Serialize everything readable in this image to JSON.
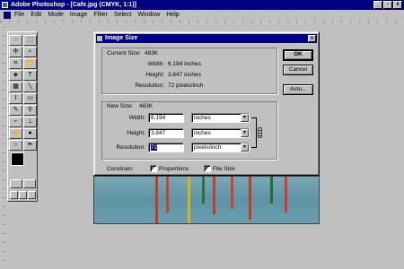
{
  "app": {
    "title": "Adobe Photoshop - [Cafe.jpg  (CMYK, 1:1)]"
  },
  "menu": [
    "File",
    "Edit",
    "Mode",
    "Image",
    "Filter",
    "Select",
    "Window",
    "Help"
  ],
  "tools": [
    "lasso",
    "marquee",
    "move",
    "magnifier",
    "crop",
    "hand",
    "paint-bucket",
    "type",
    "gradient",
    "line",
    "eyedropper",
    "eraser",
    "pencil",
    "airbrush",
    "paintbrush",
    "stamp",
    "smudge",
    "blur",
    "dodge",
    "pen"
  ],
  "dialog": {
    "title": "Image Size",
    "current": {
      "size_label": "Current Size:",
      "size_value": "483K",
      "width_label": "Width:",
      "width_value": "6.194 inches",
      "height_label": "Height:",
      "height_value": "3.847 inches",
      "resolution_label": "Resolution:",
      "resolution_value": "72 pixels/inch"
    },
    "new": {
      "size_label": "New Size:",
      "size_value": "483K",
      "width_label": "Width:",
      "width_value": "6.194",
      "width_unit": "inches",
      "height_label": "Height:",
      "height_value": "3.847",
      "height_unit": "inches",
      "resolution_label": "Resolution:",
      "resolution_value": "72",
      "resolution_unit": "pixels/inch"
    },
    "constrain": {
      "label": "Constrain:",
      "proportions_label": "Proportions",
      "proportions_checked": true,
      "filesize_label": "File Size",
      "filesize_checked": true
    },
    "buttons": {
      "ok": "OK",
      "cancel": "Cancel",
      "auto": "Auto..."
    }
  },
  "colors": {
    "titlebar": "#000080",
    "face": "#c0c0c0",
    "photo_water": "#6b9fb0"
  }
}
